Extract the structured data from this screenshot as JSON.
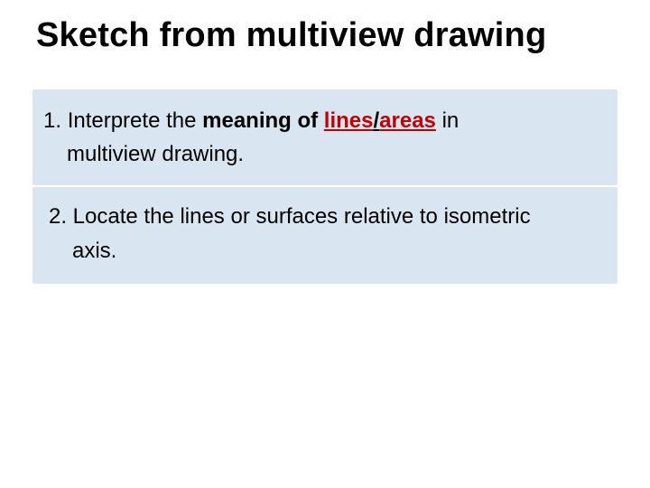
{
  "title": "Sketch from multiview drawing",
  "item1": {
    "num": "1. ",
    "lead": "Interprete the ",
    "m": "meaning of ",
    "l": "lines",
    "slash": "/",
    "a": "areas",
    "tail": " in",
    "line2": "multiview  drawing."
  },
  "item2": {
    "line1": "2. Locate the lines or surfaces relative to isometric",
    "line2": "axis."
  }
}
